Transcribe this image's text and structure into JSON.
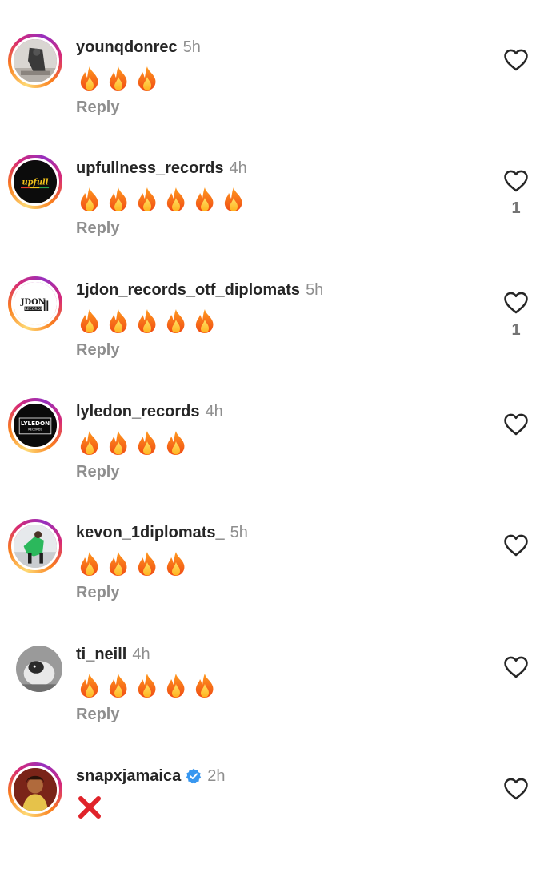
{
  "comments": [
    {
      "username": "younqdonrec",
      "time": "5h",
      "reply_label": "Reply",
      "content_icons": [
        "fire-emoji",
        "fire-emoji",
        "fire-emoji"
      ],
      "likes": ""
    },
    {
      "username": "upfullness_records",
      "time": "4h",
      "reply_label": "Reply",
      "content_icons": [
        "fire-emoji",
        "fire-emoji",
        "fire-emoji",
        "fire-emoji",
        "fire-emoji",
        "fire-emoji"
      ],
      "likes": "1"
    },
    {
      "username": "1jdon_records_otf_diplomats",
      "time": "5h",
      "reply_label": "Reply",
      "content_icons": [
        "fire-emoji",
        "fire-emoji",
        "fire-emoji",
        "fire-emoji",
        "fire-emoji"
      ],
      "likes": "1",
      "avatar_text": "JDON RECORDS"
    },
    {
      "username": "lyledon_records",
      "time": "4h",
      "reply_label": "Reply",
      "content_icons": [
        "fire-emoji",
        "fire-emoji",
        "fire-emoji",
        "fire-emoji"
      ],
      "likes": "",
      "avatar_text": "LYLEDON RECORDS"
    },
    {
      "username": "kevon_1diplomats_",
      "time": "5h",
      "reply_label": "Reply",
      "content_icons": [
        "fire-emoji",
        "fire-emoji",
        "fire-emoji",
        "fire-emoji"
      ],
      "likes": ""
    },
    {
      "username": "ti_neill",
      "time": "4h",
      "reply_label": "Reply",
      "content_icons": [
        "fire-emoji",
        "fire-emoji",
        "fire-emoji",
        "fire-emoji",
        "fire-emoji"
      ],
      "likes": ""
    },
    {
      "username": "snapxjamaica",
      "time": "2h",
      "verified": true,
      "content_icons": [
        "red-cross-emoji"
      ],
      "likes": ""
    }
  ],
  "colors": {
    "username": "#262626",
    "secondary": "#8e8e8e",
    "verified": "#3897f0",
    "cross": "#e0232a"
  },
  "icons": {
    "like": "heart-outline-icon",
    "verified": "verified-badge-icon"
  }
}
